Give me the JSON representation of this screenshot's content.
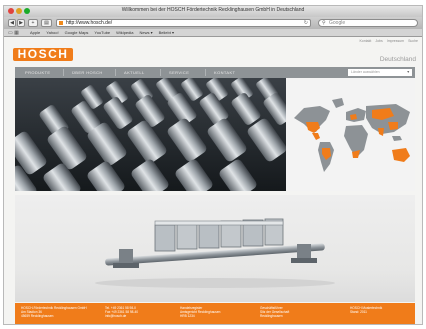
{
  "browser": {
    "window_title": "Willkommen bei der HOSCH Fördertechnik Recklinghausen GmbH in Deutschland",
    "url": "http://www.hosch.de/",
    "search_placeholder": "Google",
    "bookmarks": [
      "Apple",
      "Yahoo!",
      "Google Maps",
      "YouTube",
      "Wikipedia",
      "News ▾",
      "Beliebt ▾"
    ]
  },
  "site": {
    "logo_text": "HOSCH",
    "country": "Deutschland",
    "util_links": [
      "Kontakt",
      "Jobs",
      "Impressum",
      "Suche"
    ],
    "nav": [
      "PRODUKTE",
      "ÜBER HOSCH",
      "AKTUELL",
      "SERVICE",
      "KONTAKT"
    ],
    "lang_select_placeholder": "Länder auswählen",
    "product_caption": "",
    "footer": {
      "col1": [
        "HOSCH-Fördertechnik Recklinghausen GmbH",
        "Am Stadion 36",
        "45659 Recklinghausen"
      ],
      "col2": [
        "Tel. +49 2361 58 98-0",
        "Fax +49 2361 58 98-40",
        "info@hosch.de"
      ],
      "col3": [
        "Handelsregister",
        "Amtsgericht Recklinghausen",
        "HRB 1234"
      ],
      "col4": [
        "Geschäftsführer",
        "Sitz der Gesellschaft",
        "Recklinghausen"
      ],
      "col5": [
        "HOSCH Mustertechnik",
        "Stand: 2011",
        ""
      ]
    }
  },
  "colors": {
    "brand_orange": "#f07c1a",
    "nav_gray": "#8e9396"
  }
}
